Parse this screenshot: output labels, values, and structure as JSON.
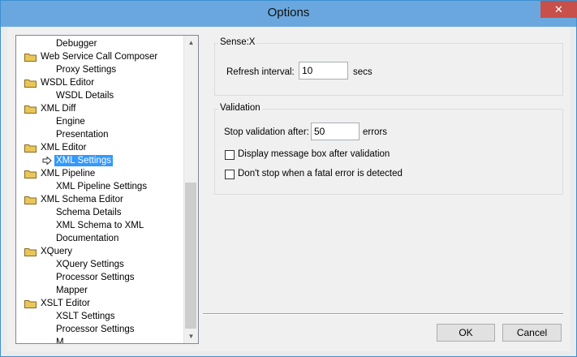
{
  "window": {
    "title": "Options",
    "close_glyph": "✕"
  },
  "tree": {
    "items": [
      {
        "label": "Debugger",
        "level": 1
      },
      {
        "label": "Web Service Call Composer",
        "level": 0
      },
      {
        "label": "Proxy Settings",
        "level": 1
      },
      {
        "label": "WSDL Editor",
        "level": 0
      },
      {
        "label": "WSDL Details",
        "level": 1
      },
      {
        "label": "XML Diff",
        "level": 0
      },
      {
        "label": "Engine",
        "level": 1
      },
      {
        "label": "Presentation",
        "level": 1
      },
      {
        "label": "XML Editor",
        "level": 0
      },
      {
        "label": "XML Settings",
        "level": 1,
        "selected": true
      },
      {
        "label": "XML Pipeline",
        "level": 0
      },
      {
        "label": "XML Pipeline Settings",
        "level": 1
      },
      {
        "label": "XML Schema Editor",
        "level": 0
      },
      {
        "label": "Schema Details",
        "level": 1
      },
      {
        "label": "XML Schema to XML",
        "level": 1
      },
      {
        "label": "Documentation",
        "level": 1
      },
      {
        "label": "XQuery",
        "level": 0
      },
      {
        "label": "XQuery Settings",
        "level": 1
      },
      {
        "label": "Processor Settings",
        "level": 1
      },
      {
        "label": "Mapper",
        "level": 1
      },
      {
        "label": "XSLT Editor",
        "level": 0
      },
      {
        "label": "XSLT Settings",
        "level": 1
      },
      {
        "label": "Processor Settings",
        "level": 1
      },
      {
        "label": "M",
        "level": 1
      }
    ]
  },
  "sensex": {
    "title": "Sense:X",
    "refresh_label": "Refresh interval:",
    "refresh_value": "10",
    "refresh_unit": "secs"
  },
  "validation": {
    "title": "Validation",
    "stop_label": "Stop validation after:",
    "stop_value": "50",
    "stop_unit": "errors",
    "msgbox_label": "Display message box after validation",
    "msgbox_checked": false,
    "fatal_label": "Don't stop when a fatal error is detected",
    "fatal_checked": false
  },
  "buttons": {
    "ok": "OK",
    "cancel": "Cancel"
  },
  "colors": {
    "titlebar": "#6aa7de",
    "close": "#c7504a",
    "selection": "#3399ff",
    "folder": "#e8c65a"
  }
}
